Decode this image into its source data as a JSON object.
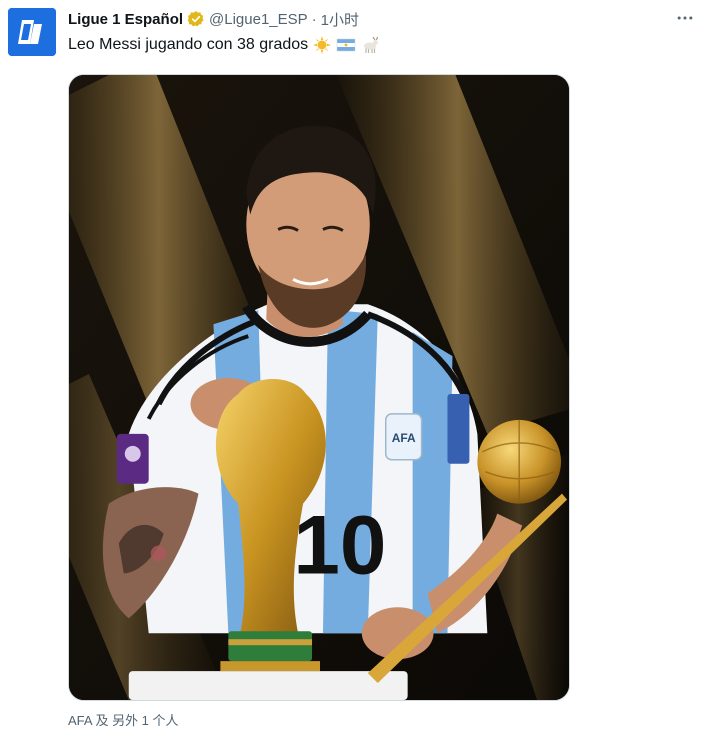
{
  "tweet": {
    "display_name": "Ligue 1 Español",
    "handle": "@Ligue1_ESP",
    "separator": "·",
    "time": "1小时",
    "text": "Leo Messi jugando con 38 grados",
    "emojis": [
      "sun-emoji",
      "argentina-flag-emoji",
      "goat-emoji"
    ],
    "tagged": "AFA 及 另外 1 个人",
    "more_icon": "more-horizontal-icon",
    "verified_color": "#e2b719",
    "avatar_color": "#1d6fe0",
    "jersey_number": "10",
    "crest_text": "AFA"
  }
}
